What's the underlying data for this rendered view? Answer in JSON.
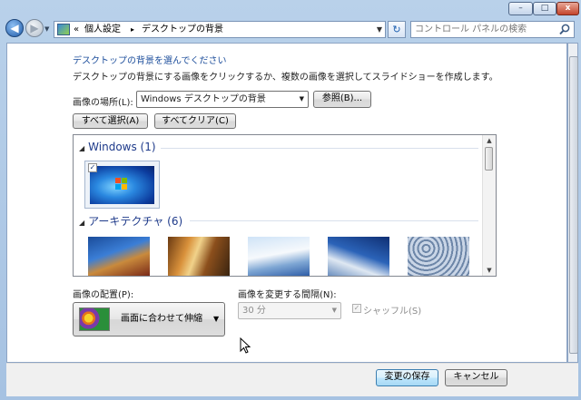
{
  "window": {
    "controls": {
      "minimize": "–",
      "maximize": "□",
      "close": "x"
    }
  },
  "nav": {
    "back_icon": "◀",
    "forward_icon": "▶",
    "address": {
      "chevrons": "«",
      "crumb1": "個人設定",
      "sep": "▸",
      "crumb2": "デスクトップの背景",
      "dropdown": "▼"
    },
    "refresh_icon": "↻",
    "search_placeholder": "コントロール パネルの検索"
  },
  "main": {
    "title": "デスクトップの背景を選んでください",
    "description": "デスクトップの背景にする画像をクリックするか、複数の画像を選択してスライドショーを作成します。",
    "location_label": "画像の場所(L):",
    "location_value": "Windows デスクトップの背景",
    "browse_button": "参照(B)...",
    "select_all_button": "すべて選択(A)",
    "clear_all_button": "すべてクリア(C)",
    "groups": [
      {
        "name": "Windows (1)",
        "items": [
          {
            "checked": true,
            "check_mark": "✓"
          }
        ]
      },
      {
        "name": "アーキテクチャ (6)",
        "items": [
          {},
          {},
          {},
          {},
          {}
        ]
      }
    ],
    "scroll_up": "▲",
    "scroll_down": "▼",
    "position_label": "画像の配置(P):",
    "position_value": "画面に合わせて伸縮",
    "interval_label": "画像を変更する間隔(N):",
    "interval_value": "30 分",
    "shuffle_label": "シャッフル(S)",
    "shuffle_checked": true
  },
  "footer": {
    "save_button": "変更の保存",
    "cancel_button": "キャンセル"
  },
  "colors": {
    "link_blue": "#1e4f9c",
    "frame_blue": "#b9d1ea",
    "group_header": "#1e3a8a"
  },
  "icons": [
    "back-arrow-icon",
    "forward-arrow-icon",
    "control-panel-icon",
    "refresh-icon",
    "search-icon",
    "expand-triangle-icon",
    "checkbox-icon",
    "mouse-cursor-icon"
  ]
}
